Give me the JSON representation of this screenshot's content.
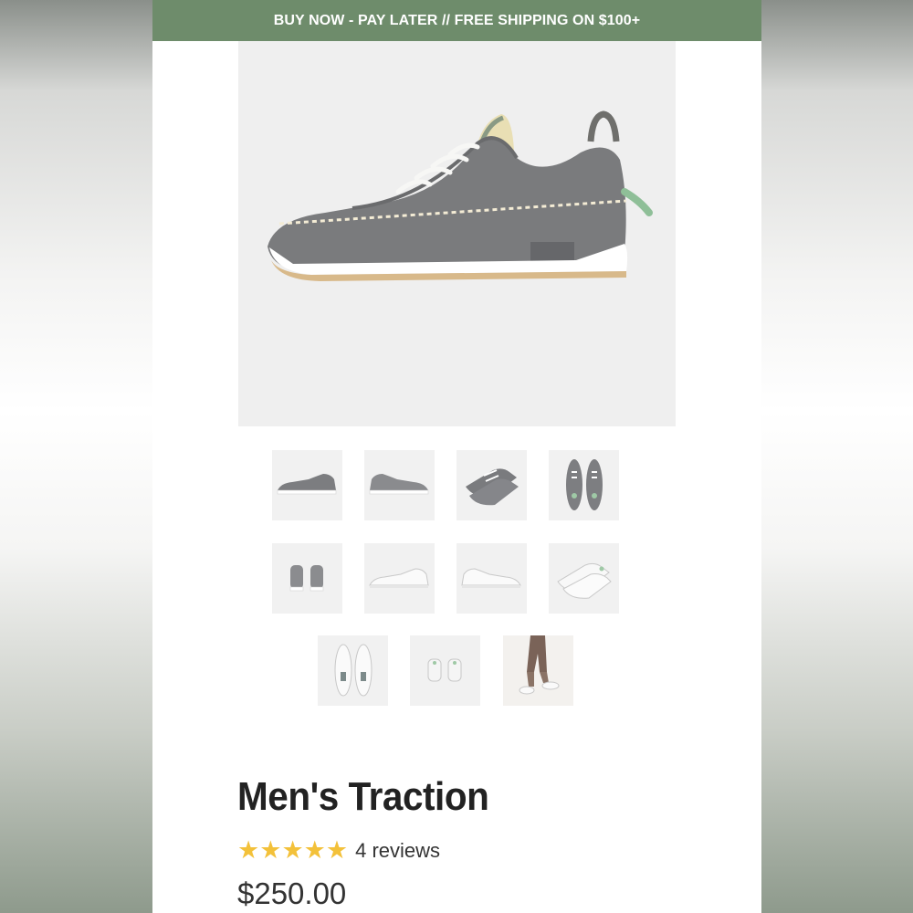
{
  "banner": {
    "text": "BUY NOW - PAY LATER // FREE SHIPPING ON $100+"
  },
  "product": {
    "title": "Men's Traction",
    "rating": 5,
    "reviews_label": "4 reviews",
    "price": "$250.00"
  },
  "colors": {
    "banner_bg": "#6e8c6b",
    "star": "#f3c13a"
  },
  "gallery": {
    "main_image": "sneaker-grey-side-view",
    "thumbnails": [
      "grey-side",
      "grey-side-alt",
      "grey-angle",
      "grey-top",
      "grey-back",
      "white-side",
      "white-side-alt",
      "white-angle",
      "white-top",
      "white-back",
      "on-foot"
    ]
  }
}
